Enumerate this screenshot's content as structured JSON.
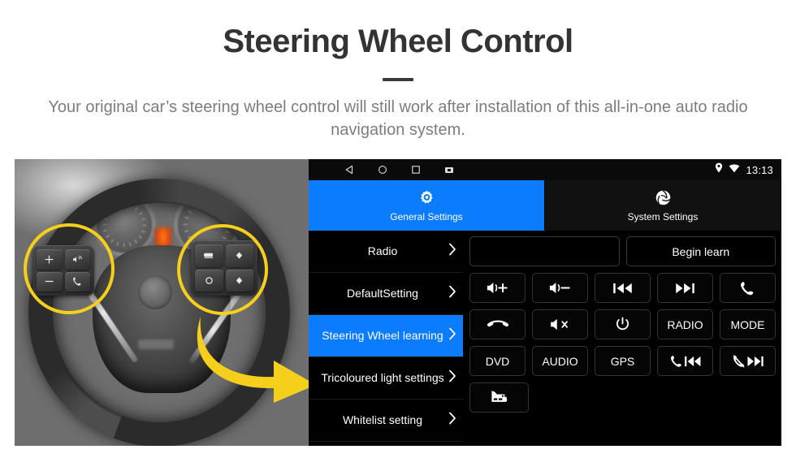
{
  "header": {
    "title": "Steering Wheel Control",
    "subtitle": "Your original car’s steering wheel control will still work after installation of this all-in-one auto radio navigation system."
  },
  "photo": {
    "name": "steering-wheel-photo",
    "left_pad_keys": [
      "volume-up-icon",
      "voice-command-icon",
      "volume-down-icon",
      "phone-call-icon"
    ],
    "right_pad_keys": [
      "display-mode-icon",
      "arrow-up-icon",
      "circle-ok-icon",
      "arrow-down-icon"
    ],
    "highlight_color": "#f5cf1b",
    "arrow_color": "#f5cf1b"
  },
  "head_unit": {
    "status_bar": {
      "nav_icons": [
        "back-icon",
        "home-icon",
        "recents-icon",
        "screenshot-icon"
      ],
      "right_icons": [
        "location-pin-icon",
        "wifi-icon"
      ],
      "clock": "13:13"
    },
    "tabs": [
      {
        "label": "General Settings",
        "icon": "gear-icon",
        "active": true
      },
      {
        "label": "System Settings",
        "icon": "system-logo-icon",
        "active": false
      }
    ],
    "menu": {
      "items": [
        {
          "label": "Radio",
          "selected": false
        },
        {
          "label": "DefaultSetting",
          "selected": false
        },
        {
          "label": "Steering Wheel learning",
          "selected": true
        },
        {
          "label": "Tricoloured light settings",
          "selected": false
        },
        {
          "label": "Whitelist setting",
          "selected": false
        }
      ],
      "chevron_icon": "chevron-right-icon"
    },
    "panel": {
      "learn_field_value": "",
      "begin_learn_label": "Begin learn",
      "rows": [
        [
          {
            "label": "",
            "icon": "volume-up-icon",
            "name": "key-volume-up"
          },
          {
            "label": "",
            "icon": "volume-down-icon",
            "name": "key-volume-down"
          },
          {
            "label": "",
            "icon": "previous-track-icon",
            "name": "key-previous"
          },
          {
            "label": "",
            "icon": "next-track-icon",
            "name": "key-next"
          },
          {
            "label": "",
            "icon": "phone-answer-icon",
            "name": "key-answer"
          }
        ],
        [
          {
            "label": "",
            "icon": "phone-hangup-icon",
            "name": "key-hangup"
          },
          {
            "label": "",
            "icon": "volume-mute-icon",
            "name": "key-mute"
          },
          {
            "label": "",
            "icon": "power-icon",
            "name": "key-power"
          },
          {
            "label": "RADIO",
            "icon": "",
            "name": "key-radio"
          },
          {
            "label": "MODE",
            "icon": "",
            "name": "key-mode"
          }
        ],
        [
          {
            "label": "DVD",
            "icon": "",
            "name": "key-dvd"
          },
          {
            "label": "AUDIO",
            "icon": "",
            "name": "key-audio"
          },
          {
            "label": "GPS",
            "icon": "",
            "name": "key-gps"
          },
          {
            "label": "",
            "icon": "phone-previous-icon",
            "name": "key-phone-previous"
          },
          {
            "label": "",
            "icon": "phone-mute-next-icon",
            "name": "key-phone-mute-next"
          }
        ],
        [
          {
            "label": "",
            "icon": "car-icon",
            "name": "key-car"
          }
        ]
      ]
    },
    "accent_color": "#0a7cfd"
  }
}
